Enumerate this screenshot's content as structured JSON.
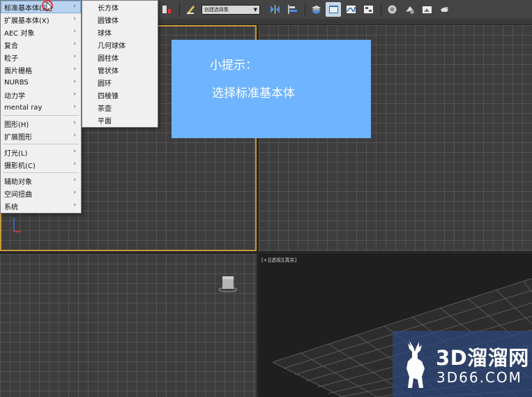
{
  "toolbar": {
    "selection_set_value": "创建选择集",
    "icons": [
      "snap-toggle-icon",
      "edit-named-selection-icon",
      "mirror-icon",
      "align-icon",
      "layer-manager-icon",
      "scene-explorer-icon",
      "curve-editor-icon",
      "schematic-view-icon",
      "material-editor-icon",
      "render-setup-icon",
      "rendered-frame-icon",
      "render-icon"
    ]
  },
  "create_menu": {
    "items": [
      {
        "label": "标准基本体(S)",
        "has_submenu": true,
        "selected": true
      },
      {
        "label": "扩展基本体(X)",
        "has_submenu": true
      },
      {
        "label": "AEC 对象",
        "has_submenu": true
      },
      {
        "label": "复合",
        "has_submenu": true
      },
      {
        "label": "粒子",
        "has_submenu": true
      },
      {
        "label": "面片栅格",
        "has_submenu": true
      },
      {
        "label": "NURBS",
        "has_submenu": true
      },
      {
        "label": "动力学",
        "has_submenu": true
      },
      {
        "label": "mental ray",
        "has_submenu": true
      },
      {
        "label": "图形(H)",
        "has_submenu": true
      },
      {
        "label": "扩展图形",
        "has_submenu": true
      },
      {
        "label": "灯光(L)",
        "has_submenu": true
      },
      {
        "label": "摄影机(C)",
        "has_submenu": true
      },
      {
        "label": "辅助对象",
        "has_submenu": true
      },
      {
        "label": "空间扭曲",
        "has_submenu": true
      },
      {
        "label": "系统",
        "has_submenu": true
      }
    ]
  },
  "primitives_submenu": {
    "items": [
      "长方体",
      "圆锥体",
      "球体",
      "几何球体",
      "圆柱体",
      "管状体",
      "圆环",
      "四棱锥",
      "茶壶",
      "平面"
    ]
  },
  "hint": {
    "title": "小提示：",
    "body": "选择标准基本体",
    "color": "#6eb4ff"
  },
  "viewport_br": {
    "label": "[+][透视][真实]"
  },
  "watermark": {
    "name": "3D溜溜网",
    "url": "3D66.COM"
  },
  "colors": {
    "active_viewport_border": "#c59a3a",
    "menu_highlight": "#b9d3f0"
  }
}
